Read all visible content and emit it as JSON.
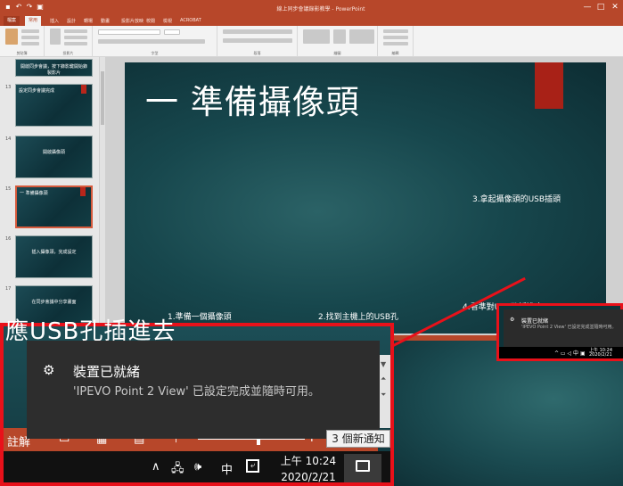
{
  "window": {
    "title": "線上同步會議錄影教學 - PowerPoint",
    "controls": [
      "—",
      "□",
      "✕"
    ]
  },
  "ribbon_tabs": [
    "檔案",
    "常用",
    "插入",
    "設計",
    "轉場",
    "動畫",
    "投影片放映",
    "校閱",
    "檢視",
    "ACROBAT"
  ],
  "ribbon_groups": [
    "剪貼簿",
    "投影片",
    "字型",
    "段落",
    "繪圖",
    "編輯"
  ],
  "thumbnails": [
    {
      "num": "",
      "title": "開啟同步會議，按下錄影鍵開始錄製影片"
    },
    {
      "num": "13",
      "title": "設定同步會議完成"
    },
    {
      "num": "14",
      "title": "開啟攝像頭"
    },
    {
      "num": "15",
      "title": "一 準備攝像頭"
    },
    {
      "num": "16",
      "title": "插入攝像頭，完成設定"
    },
    {
      "num": "17",
      "title": "在同步會議中分享畫面"
    }
  ],
  "slide": {
    "title": "一 準備攝像頭",
    "step1": "1.準備一個攝像頭",
    "step2": "2.找到主機上的USB孔",
    "step3": "3.拿起攝像頭的USB插頭",
    "step4": "4.看準對USB孔插進去",
    "zoom_fragment": "應USB孔插進去"
  },
  "notification": {
    "icon": "gear-icon",
    "title": "裝置已就緒",
    "message": "'IPEVO Point 2 View' 已設定完成並隨時可用。",
    "new_count_label": "3 個新通知"
  },
  "taskbar": {
    "notes_label": "註解",
    "ime": "中",
    "time": "上午 10:24",
    "date": "2020/2/21"
  },
  "small_notification": {
    "title": "裝置已就緒",
    "message": "'IPEVO Point 2 View' 已設定完成並隨時可用。",
    "time": "上午 10:24",
    "date": "2020/2/21"
  },
  "colors": {
    "ppt_accent": "#b7472a",
    "highlight_red": "#e8111a",
    "toast_bg": "#2d2d2d"
  }
}
